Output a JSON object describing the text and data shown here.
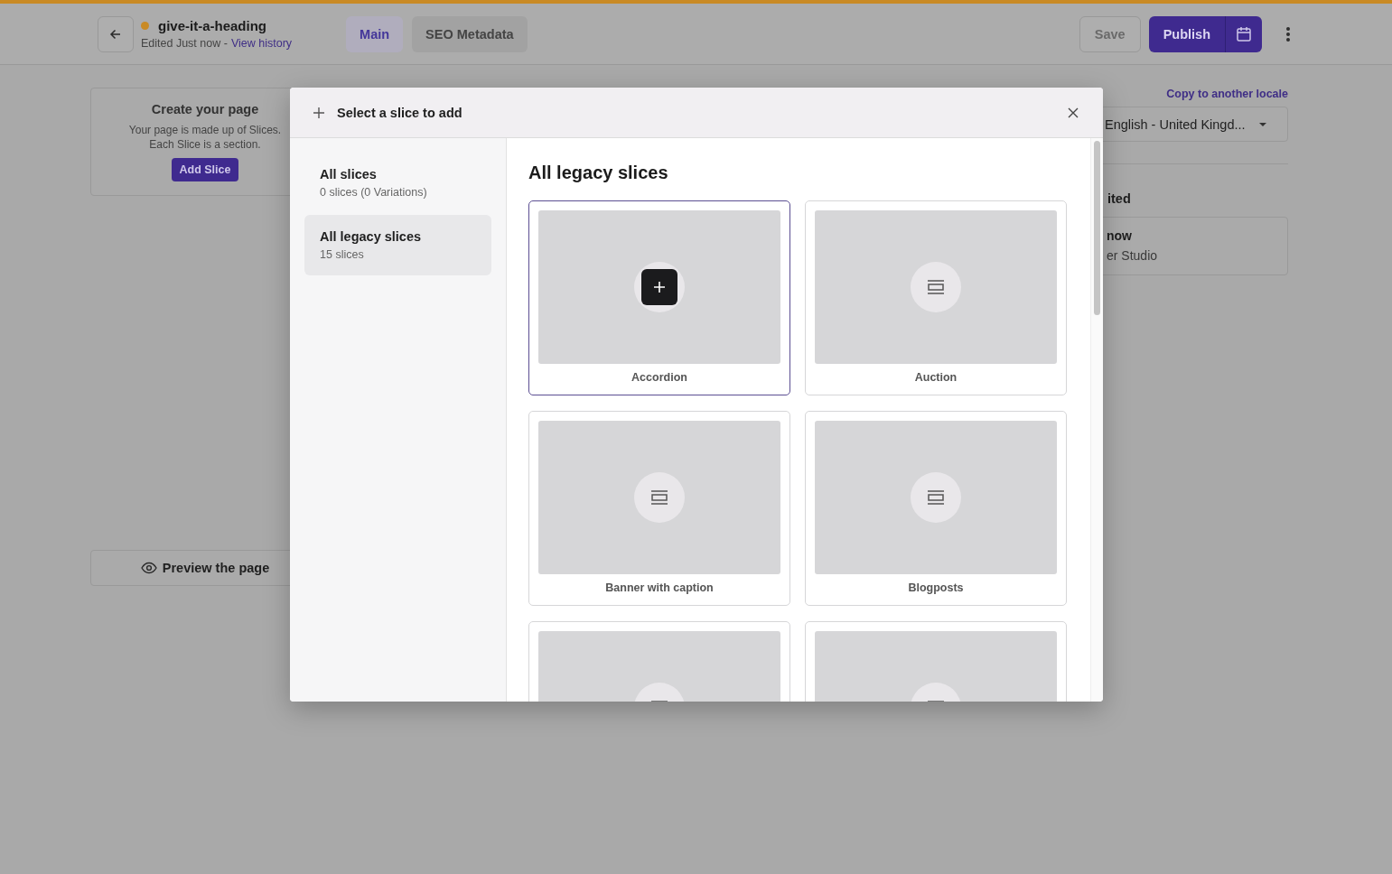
{
  "document": {
    "title": "give-it-a-heading",
    "edited": "Edited Just now -",
    "history_link": "View history"
  },
  "tabs": [
    {
      "label": "Main",
      "selected": true
    },
    {
      "label": "SEO Metadata",
      "selected": false
    }
  ],
  "actions": {
    "save": {
      "label": "Save",
      "disabled": true
    },
    "publish": "Publish"
  },
  "builder": {
    "title": "Create your page",
    "description": "Your page is made up of Slices. Each Slice is a section.",
    "button": "Add Slice",
    "preview": "Preview the page"
  },
  "side_panel": {
    "copy_link": "Copy to another locale",
    "locale": "English - United Kingd...",
    "section_heading": "ited",
    "entry_title": "now",
    "entry_subtitle": "er Studio"
  },
  "modal": {
    "title": "Select a slice to add",
    "categories": [
      {
        "name": "All slices",
        "count": "0 slices (0 Variations)",
        "selected": false
      },
      {
        "name": "All legacy slices",
        "count": "15 slices",
        "selected": true
      }
    ],
    "heading": "All legacy slices",
    "slices": [
      {
        "name": "Accordion",
        "kind": "add",
        "selected": true
      },
      {
        "name": "Auction",
        "kind": "slice",
        "selected": false
      },
      {
        "name": "Banner with caption",
        "kind": "slice",
        "selected": false
      },
      {
        "name": "Blogposts",
        "kind": "slice",
        "selected": false
      },
      {
        "kind": "slice",
        "selected": false
      },
      {
        "kind": "slice",
        "selected": false
      }
    ]
  }
}
